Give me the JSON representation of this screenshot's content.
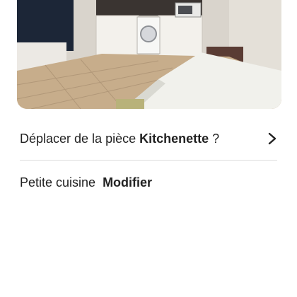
{
  "room_photo": {
    "description_icon": "room-photo"
  },
  "move_room": {
    "prefix": "Déplacer de la pièce",
    "room_name": "Kitchenette",
    "suffix": " ?",
    "icon": "chevron-right-icon"
  },
  "room_subtype": {
    "label": "Petite cuisine",
    "edit_label": "Modifier"
  },
  "colors": {
    "text": "#222222",
    "divider": "#dddddd",
    "background": "#ffffff"
  }
}
